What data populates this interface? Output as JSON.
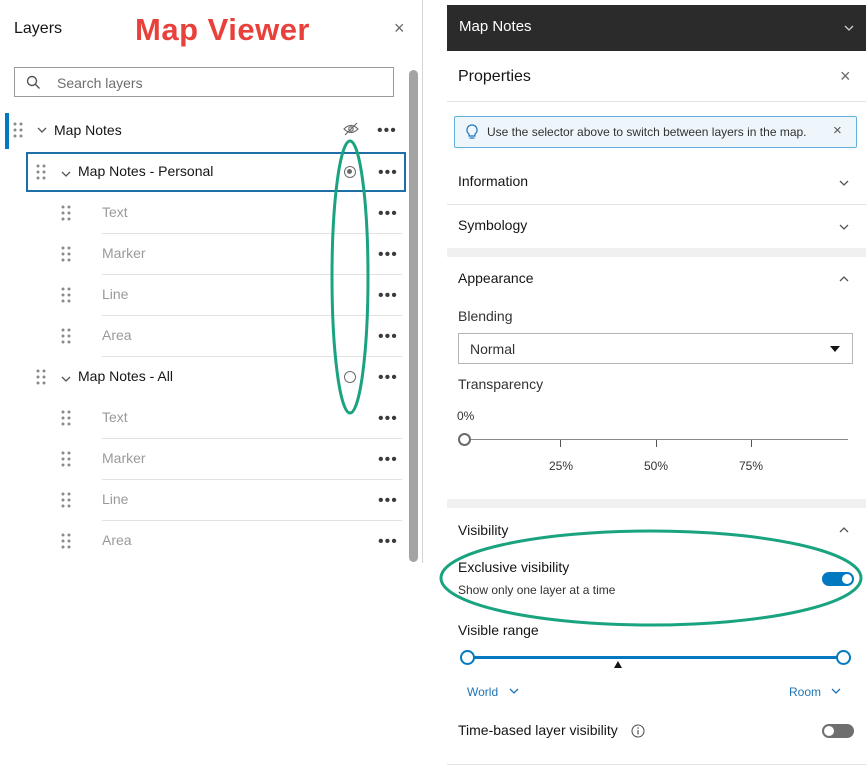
{
  "watermark": "Map Viewer",
  "layers_panel": {
    "title": "Layers",
    "close": "×",
    "search": {
      "placeholder": "Search layers",
      "value": ""
    },
    "group": {
      "label": "Map Notes"
    },
    "subgroups": [
      {
        "label": "Map Notes - Personal",
        "selected": true,
        "items": [
          "Text",
          "Marker",
          "Line",
          "Area"
        ]
      },
      {
        "label": "Map Notes - All",
        "selected": false,
        "items": [
          "Text",
          "Marker",
          "Line",
          "Area"
        ]
      }
    ],
    "more": "•••"
  },
  "right_panel": {
    "header": {
      "title": "Map Notes",
      "chevron": "⌄"
    },
    "properties": {
      "title": "Properties",
      "close": "×"
    },
    "notice": {
      "text": "Use the selector above to switch between layers in the map.",
      "close": "×"
    },
    "sections": {
      "information": "Information",
      "symbology": "Symbology",
      "appearance": "Appearance",
      "visibility": "Visibility"
    },
    "appearance": {
      "blending_label": "Blending",
      "blending_value": "Normal",
      "transparency_label": "Transparency",
      "transparency_value": "0%",
      "transparency_fraction": 0,
      "ticks": [
        "25%",
        "50%",
        "75%"
      ]
    },
    "visibility": {
      "exclusive_title": "Exclusive visibility",
      "exclusive_desc": "Show only one layer at a time",
      "exclusive_on": true,
      "range_label": "Visible range",
      "range_min": "World",
      "range_max": "Room",
      "time_label": "Time-based layer visibility",
      "time_on": false
    }
  },
  "colors": {
    "accent": "#0079c1",
    "annotation": "#1aa37f",
    "watermark": "#e8413b"
  },
  "icons": {
    "search": "search-icon",
    "eye_off": "eye-off-icon",
    "lightbulb": "lightbulb-icon",
    "info": "info-icon"
  }
}
